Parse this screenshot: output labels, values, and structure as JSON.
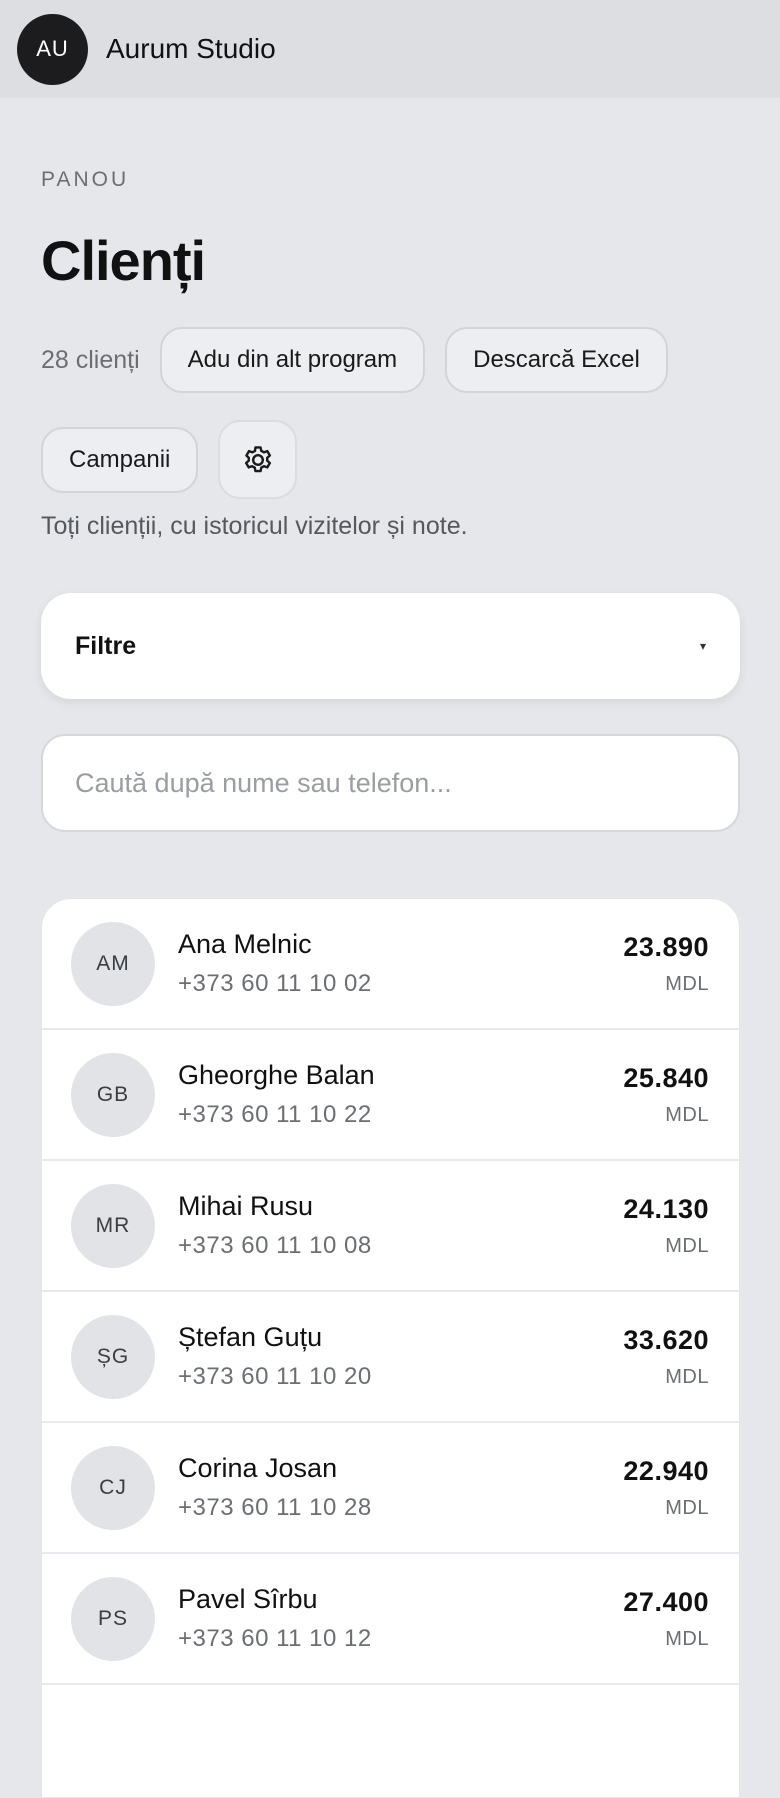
{
  "header": {
    "org_initials": "AU",
    "org_name": "Aurum Studio"
  },
  "page": {
    "eyebrow": "PANOU",
    "title": "Clienți",
    "count": "28 clienți",
    "import_label": "Adu din alt program",
    "export_label": "Descarcă Excel",
    "campaigns_label": "Campanii",
    "settings_icon": "gear-icon",
    "subtitle": "Toți clienții, cu istoricul vizitelor și note."
  },
  "filters": {
    "label": "Filtre",
    "caret": "▾"
  },
  "search": {
    "placeholder": "Caută după nume sau telefon...",
    "value": ""
  },
  "clients": [
    {
      "initials": "AM",
      "name": "Ana Melnic",
      "phone": "+373 60 11 10 02",
      "amount": "23.890",
      "currency": "MDL"
    },
    {
      "initials": "GB",
      "name": "Gheorghe Balan",
      "phone": "+373 60 11 10 22",
      "amount": "25.840",
      "currency": "MDL"
    },
    {
      "initials": "MR",
      "name": "Mihai Rusu",
      "phone": "+373 60 11 10 08",
      "amount": "24.130",
      "currency": "MDL"
    },
    {
      "initials": "ȘG",
      "name": "Ștefan Guțu",
      "phone": "+373 60 11 10 20",
      "amount": "33.620",
      "currency": "MDL"
    },
    {
      "initials": "CJ",
      "name": "Corina Josan",
      "phone": "+373 60 11 10 28",
      "amount": "22.940",
      "currency": "MDL"
    },
    {
      "initials": "PS",
      "name": "Pavel Sîrbu",
      "phone": "+373 60 11 10 12",
      "amount": "27.400",
      "currency": "MDL"
    }
  ]
}
